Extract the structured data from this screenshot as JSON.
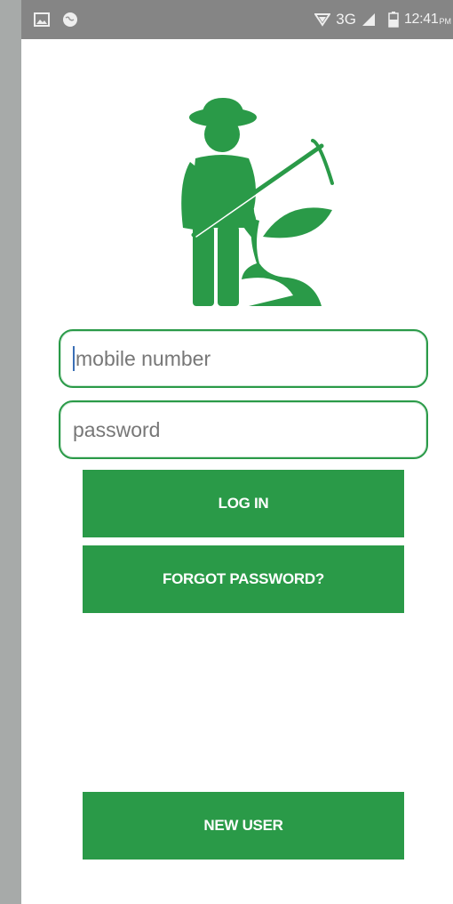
{
  "status_bar": {
    "network": "3G",
    "time": "12:41",
    "ampm": "PM",
    "icons": [
      "gallery-notification-icon",
      "globe-notification-icon",
      "signal-strength-icon",
      "cellular-signal-icon",
      "battery-icon"
    ]
  },
  "logo": {
    "icon": "farmer-with-hoe-and-plant-icon",
    "color": "#2a9a48"
  },
  "form": {
    "mobile_placeholder": "mobile number",
    "password_placeholder": "password"
  },
  "buttons": {
    "login": "LOG IN",
    "forgot": "FORGOT PASSWORD?",
    "new_user": "NEW USER"
  },
  "colors": {
    "accent": "#2a9a48",
    "statusbar": "#858585"
  }
}
